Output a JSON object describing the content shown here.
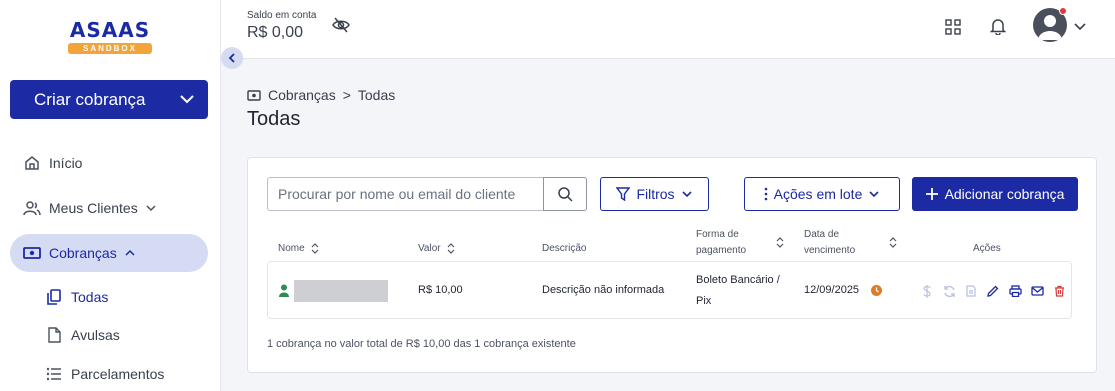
{
  "brand": {
    "logo_text": "ASAAS",
    "logo_badge": "SANDBOX",
    "accent": "#1c2aa3",
    "badge_color": "#f2a33a"
  },
  "sidebar": {
    "create_label": "Criar cobrança",
    "items": [
      {
        "label": "Início",
        "icon": "home-icon"
      },
      {
        "label": "Meus Clientes",
        "icon": "users-icon"
      },
      {
        "label": "Cobranças",
        "icon": "money-icon"
      }
    ],
    "subitems": [
      {
        "label": "Todas",
        "icon": "copy-icon"
      },
      {
        "label": "Avulsas",
        "icon": "file-icon"
      },
      {
        "label": "Parcelamentos",
        "icon": "list-icon"
      }
    ]
  },
  "header": {
    "saldo_label": "Saldo em conta",
    "saldo_value": "R$ 0,00"
  },
  "breadcrumb": {
    "parent": "Cobranças",
    "separator": ">",
    "current": "Todas"
  },
  "page": {
    "title": "Todas"
  },
  "toolbar": {
    "search_placeholder": "Procurar por nome ou email do cliente",
    "filters_label": "Filtros",
    "batch_label": "Ações em lote",
    "add_label": "Adicionar cobrança"
  },
  "table": {
    "headers": {
      "name": "Nome",
      "value": "Valor",
      "description": "Descrição",
      "payment_line1": "Forma de",
      "payment_line2": "pagamento",
      "due_line1": "Data de",
      "due_line2": "vencimento",
      "actions": "Ações"
    },
    "rows": [
      {
        "value": "R$ 10,00",
        "description": "Descrição não informada",
        "payment_line1": "Boleto Bancário /",
        "payment_line2": "Pix",
        "due": "12/09/2025"
      }
    ]
  },
  "footer": {
    "summary": "1 cobrança no valor total de R$ 10,00 das 1 cobrança existente"
  }
}
